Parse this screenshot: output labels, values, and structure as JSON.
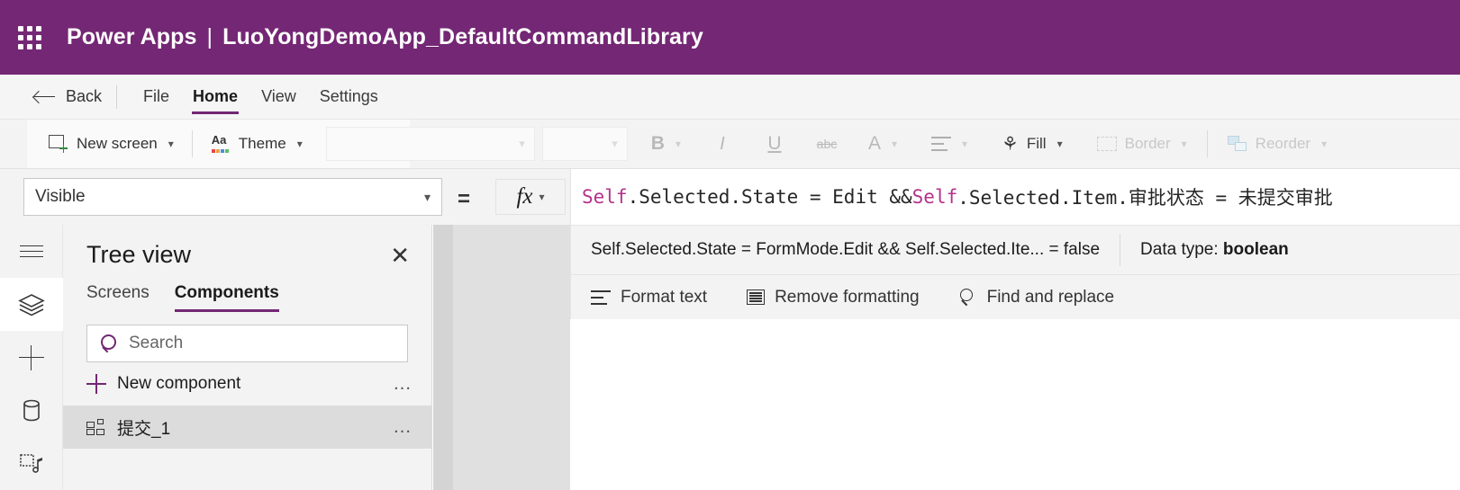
{
  "topbar": {
    "waffle_icon": "app-launcher-waffle-icon",
    "product": "Power Apps",
    "separator": "|",
    "app_name": "LuoYongDemoApp_DefaultCommandLibrary",
    "background_color": "#742774"
  },
  "menubar": {
    "back_label": "Back",
    "items": [
      {
        "label": "File",
        "active": false
      },
      {
        "label": "Home",
        "active": true
      },
      {
        "label": "View",
        "active": false
      },
      {
        "label": "Settings",
        "active": false
      }
    ],
    "accent_color": "#742774"
  },
  "ribbon": {
    "new_screen": "New screen",
    "theme": "Theme",
    "font_family_value": "",
    "font_size_value": "",
    "bold": "B",
    "italic": "I",
    "underline": "U",
    "strikethrough": "abc",
    "font_color": "A",
    "align": "align-icon",
    "fill": "Fill",
    "border": "Border",
    "reorder": "Reorder"
  },
  "formula": {
    "property_value": "Visible",
    "equals": "=",
    "fx_label": "fx",
    "expression_tokens": [
      {
        "text": "Self",
        "type": "keyword"
      },
      {
        "text": ".Selected.State = Edit && ",
        "type": "plain"
      },
      {
        "text": "Self",
        "type": "keyword"
      },
      {
        "text": ".Selected.Item.审批状态 = 未提交审批",
        "type": "plain"
      }
    ],
    "expression_raw": "Self.Selected.State = Edit && Self.Selected.Item.审批状态 = 未提交审批",
    "result_expression": "Self.Selected.State = FormMode.Edit && Self.Selected.Ite...  =  false",
    "data_type_label": "Data type: ",
    "data_type_value": "boolean",
    "keyword_color": "#b4328c",
    "tools": [
      {
        "label": "Format text",
        "icon": "format-text-icon"
      },
      {
        "label": "Remove formatting",
        "icon": "remove-formatting-icon"
      },
      {
        "label": "Find and replace",
        "icon": "find-replace-icon"
      }
    ]
  },
  "rail": {
    "items": [
      {
        "icon": "hamburger-menu-icon",
        "active": false
      },
      {
        "icon": "layers-tree-view-icon",
        "active": true
      },
      {
        "icon": "insert-plus-icon",
        "active": false
      },
      {
        "icon": "data-cylinder-icon",
        "active": false
      },
      {
        "icon": "media-icon",
        "active": false
      }
    ]
  },
  "treeview": {
    "title": "Tree view",
    "close_icon": "close-icon",
    "tabs": [
      {
        "label": "Screens",
        "active": false
      },
      {
        "label": "Components",
        "active": true
      }
    ],
    "search_placeholder": "Search",
    "search_value": "",
    "new_component_label": "New component",
    "overflow_icon": "ellipsis-icon",
    "items": [
      {
        "label": "提交_1",
        "icon": "component-icon",
        "selected": true
      }
    ]
  }
}
